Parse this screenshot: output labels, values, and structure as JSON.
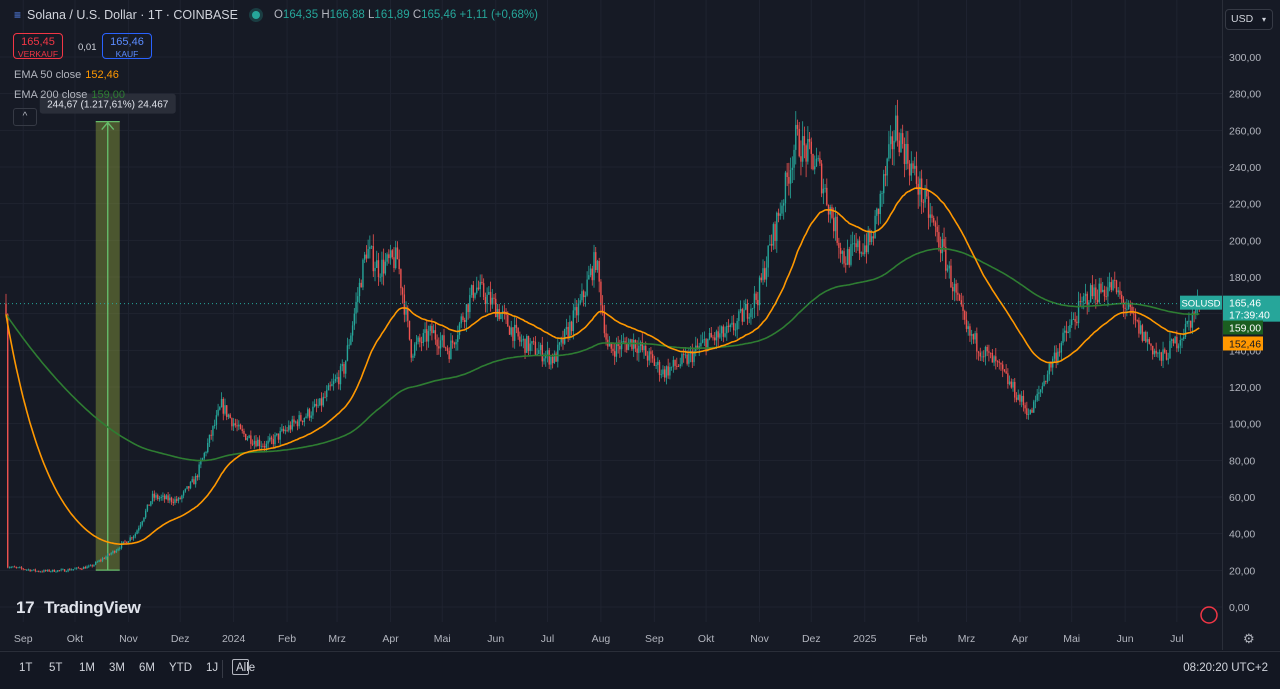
{
  "header": {
    "symbol": "Solana / U.S. Dollar · 1T · COINBASE",
    "o_label": "O",
    "o_value": "164,35",
    "h_label": "H",
    "h_value": "166,88",
    "l_label": "L",
    "l_value": "161,89",
    "c_label": "C",
    "c_value": "165,46",
    "change": "+1,11 (+0,68%)"
  },
  "trade": {
    "sell_price": "165,45",
    "sell_label": "VERKAUF",
    "spread": "0,01",
    "buy_price": "165,46",
    "buy_label": "KAUF"
  },
  "indicators": {
    "ema50_label": "EMA 50 close",
    "ema50_value": "152,46",
    "ema200_label": "EMA 200 close",
    "ema200_value": "159,00"
  },
  "collapse_icon": "chevron-up-icon",
  "currency": "USD",
  "measure_label": "244,67 (1.217,61%) 24.467",
  "price_tags": {
    "symbol": "SOLUSD",
    "last": "165,46",
    "countdown": "17:39:40",
    "ema200": "159,00",
    "ema50": "152,46"
  },
  "colors": {
    "up": "#26a69a",
    "down": "#ef5350",
    "ema50": "#ff9800",
    "ema200": "#2e7d32",
    "measure": "#66bb6a"
  },
  "brand": "TradingView",
  "toolbar": {
    "ranges": [
      "1T",
      "5T",
      "1M",
      "3M",
      "6M",
      "YTD",
      "1J",
      "Alle"
    ],
    "clock": "08:20:20 UTC+2"
  },
  "chart_data": {
    "type": "candlestick",
    "ylim": [
      0,
      300
    ],
    "y_ticks": [
      "0,00",
      "20,00",
      "40,00",
      "60,00",
      "80,00",
      "100,00",
      "120,00",
      "140,00",
      "160,00",
      "180,00",
      "200,00",
      "220,00",
      "240,00",
      "260,00",
      "280,00",
      "300,00"
    ],
    "x_ticks": [
      "Sep",
      "Okt",
      "Nov",
      "Dez",
      "2024",
      "Feb",
      "Mrz",
      "Apr",
      "Mai",
      "Jun",
      "Jul",
      "Aug",
      "Sep",
      "Okt",
      "Nov",
      "Dez",
      "2025",
      "Feb",
      "Mrz",
      "Apr",
      "Mai",
      "Jun",
      "Jul"
    ],
    "close_path": [
      [
        "2023-08-23",
        22
      ],
      [
        "2023-09-10",
        19.5
      ],
      [
        "2023-09-25",
        20
      ],
      [
        "2023-10-10",
        22
      ],
      [
        "2023-10-23",
        30
      ],
      [
        "2023-11-05",
        40
      ],
      [
        "2023-11-15",
        60
      ],
      [
        "2023-11-30",
        58
      ],
      [
        "2023-12-10",
        70
      ],
      [
        "2023-12-25",
        110
      ],
      [
        "2024-01-05",
        95
      ],
      [
        "2024-01-20",
        88
      ],
      [
        "2024-02-05",
        100
      ],
      [
        "2024-02-20",
        110
      ],
      [
        "2024-03-05",
        130
      ],
      [
        "2024-03-18",
        195
      ],
      [
        "2024-03-25",
        185
      ],
      [
        "2024-04-05",
        190
      ],
      [
        "2024-04-13",
        140
      ],
      [
        "2024-04-25",
        150
      ],
      [
        "2024-05-05",
        140
      ],
      [
        "2024-05-20",
        175
      ],
      [
        "2024-05-31",
        165
      ],
      [
        "2024-06-15",
        145
      ],
      [
        "2024-07-05",
        135
      ],
      [
        "2024-07-20",
        165
      ],
      [
        "2024-07-29",
        190
      ],
      [
        "2024-08-05",
        140
      ],
      [
        "2024-08-20",
        145
      ],
      [
        "2024-09-06",
        128
      ],
      [
        "2024-09-20",
        135
      ],
      [
        "2024-10-01",
        145
      ],
      [
        "2024-10-15",
        150
      ],
      [
        "2024-10-31",
        170
      ],
      [
        "2024-11-15",
        225
      ],
      [
        "2024-11-22",
        255
      ],
      [
        "2024-12-05",
        240
      ],
      [
        "2024-12-20",
        190
      ],
      [
        "2025-01-05",
        200
      ],
      [
        "2025-01-19",
        262
      ],
      [
        "2025-02-01",
        230
      ],
      [
        "2025-02-15",
        195
      ],
      [
        "2025-03-01",
        150
      ],
      [
        "2025-03-20",
        130
      ],
      [
        "2025-04-07",
        105
      ],
      [
        "2025-04-20",
        135
      ],
      [
        "2025-05-10",
        170
      ],
      [
        "2025-05-25",
        175
      ],
      [
        "2025-06-10",
        150
      ],
      [
        "2025-06-22",
        135
      ],
      [
        "2025-07-05",
        150
      ],
      [
        "2025-07-14",
        165.46
      ]
    ],
    "ema50_last": 152.46,
    "ema200_last": 159.0,
    "last_close": 165.46,
    "measure": {
      "from_date": "2023-10-20",
      "to_date": "2023-10-20",
      "low": 20.1,
      "high": 264.77,
      "change": "244,67 (1.217,61%) 24.467"
    }
  }
}
